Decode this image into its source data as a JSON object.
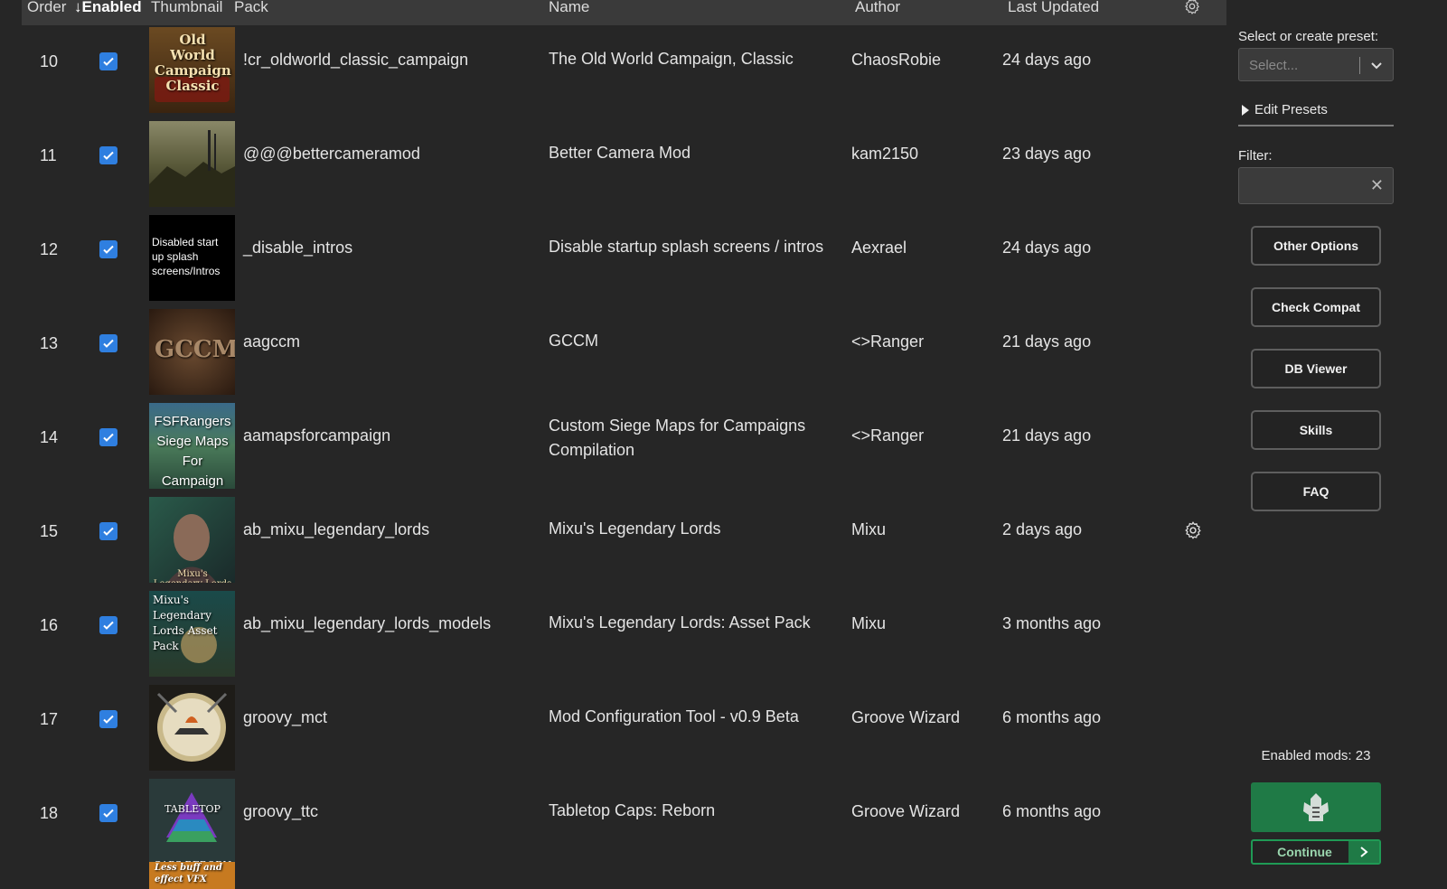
{
  "table": {
    "headers": {
      "order": "Order",
      "enabled": "↓Enabled",
      "thumbnail": "Thumbnail",
      "pack": "Pack",
      "name": "Name",
      "author": "Author",
      "last_updated": "Last Updated"
    },
    "rows": [
      {
        "order": "10",
        "enabled": true,
        "thumb_text": "Old World Campaign Classic",
        "pack": "!cr_oldworld_classic_campaign",
        "name": "The Old World Campaign, Classic",
        "author": "ChaosRobie",
        "updated": "24 days ago"
      },
      {
        "order": "11",
        "enabled": true,
        "thumb_text": "",
        "pack": "@@@bettercameramod",
        "name": "Better Camera Mod",
        "author": "kam2150",
        "updated": "23 days ago"
      },
      {
        "order": "12",
        "enabled": true,
        "thumb_text": "Disabled start up splash screens/Intros",
        "pack": "_disable_intros",
        "name": "Disable startup splash screens / intros",
        "author": "Aexrael",
        "updated": "24 days ago"
      },
      {
        "order": "13",
        "enabled": true,
        "thumb_text": "GCCM",
        "pack": "aagccm",
        "name": "GCCM",
        "author": "<>Ranger",
        "updated": "21 days ago"
      },
      {
        "order": "14",
        "enabled": true,
        "thumb_text": "FSFRangers Siege Maps For Campaign",
        "pack": "aamapsforcampaign",
        "name": "Custom Siege Maps for Campaigns Compilation",
        "author": "<>Ranger",
        "updated": "21 days ago"
      },
      {
        "order": "15",
        "enabled": true,
        "thumb_text": "Mixu's Legendary Lords",
        "pack": "ab_mixu_legendary_lords",
        "name": "Mixu's Legendary Lords",
        "author": "Mixu",
        "updated": "2 days ago"
      },
      {
        "order": "16",
        "enabled": true,
        "thumb_text": "Mixu's Legendary Lords Asset Pack",
        "pack": "ab_mixu_legendary_lords_models",
        "name": "Mixu's Legendary Lords: Asset Pack",
        "author": "Mixu",
        "updated": "3 months ago"
      },
      {
        "order": "17",
        "enabled": true,
        "thumb_text": "",
        "pack": "groovy_mct",
        "name": "Mod Configuration Tool - v0.9 Beta",
        "author": "Groove Wizard",
        "updated": "6 months ago"
      },
      {
        "order": "18",
        "enabled": true,
        "thumb_text": "TABLETOP CAPS REBORN",
        "pack": "groovy_ttc",
        "name": "Tabletop Caps: Reborn",
        "author": "Groove Wizard",
        "updated": "6 months ago"
      }
    ],
    "partial_thumb_text": "Less buff and effect VFX"
  },
  "sidebar": {
    "preset_label": "Select or create preset:",
    "preset_placeholder": "Select...",
    "edit_presets": "Edit Presets",
    "filter_label": "Filter:",
    "filter_value": "",
    "buttons": {
      "other_options": "Other Options",
      "check_compat": "Check Compat",
      "db_viewer": "DB Viewer",
      "skills": "Skills",
      "faq": "FAQ"
    },
    "enabled_mods": "Enabled mods: 23",
    "continue": "Continue"
  },
  "colors": {
    "background": "#262626",
    "header": "#3a3a3a",
    "checkbox": "#2f7fe0",
    "play_button": "#1f7a46"
  }
}
